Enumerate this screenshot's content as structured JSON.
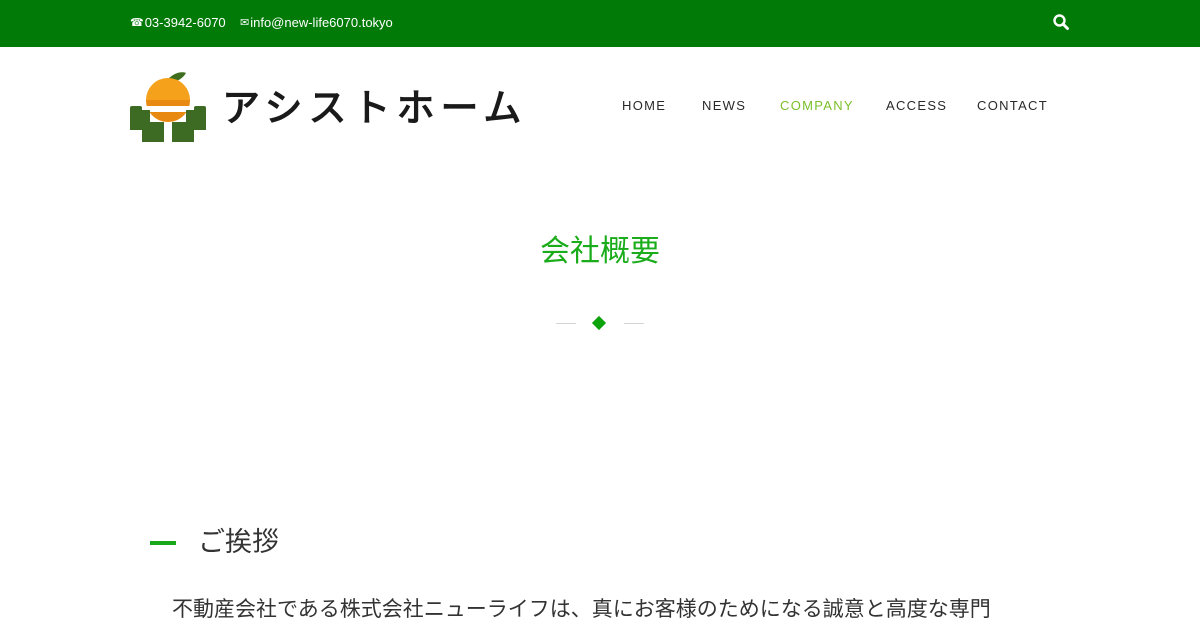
{
  "topbar": {
    "phone_icon": "☎",
    "phone": "03-3942-6070",
    "email_icon": "✉",
    "email": "info@new-life6070.tokyo",
    "search_icon": "search-icon",
    "background": "#017a07"
  },
  "brand": {
    "name": "アシストホーム",
    "logo_icon": "orange-in-hands-logo"
  },
  "nav": {
    "items": [
      {
        "label": "HOME"
      },
      {
        "label": "NEWS"
      },
      {
        "label": "COMPANY",
        "active": true
      },
      {
        "label": "ACCESS"
      },
      {
        "label": "CONTACT"
      }
    ],
    "active_color": "#7bbf2a"
  },
  "page": {
    "title": "会社概要",
    "accent_color": "#1aac1a"
  },
  "greeting": {
    "title": "ご挨拶",
    "text": "不動産会社である株式会社ニューライフは、真にお客様のためになる誠意と高度な専門"
  }
}
